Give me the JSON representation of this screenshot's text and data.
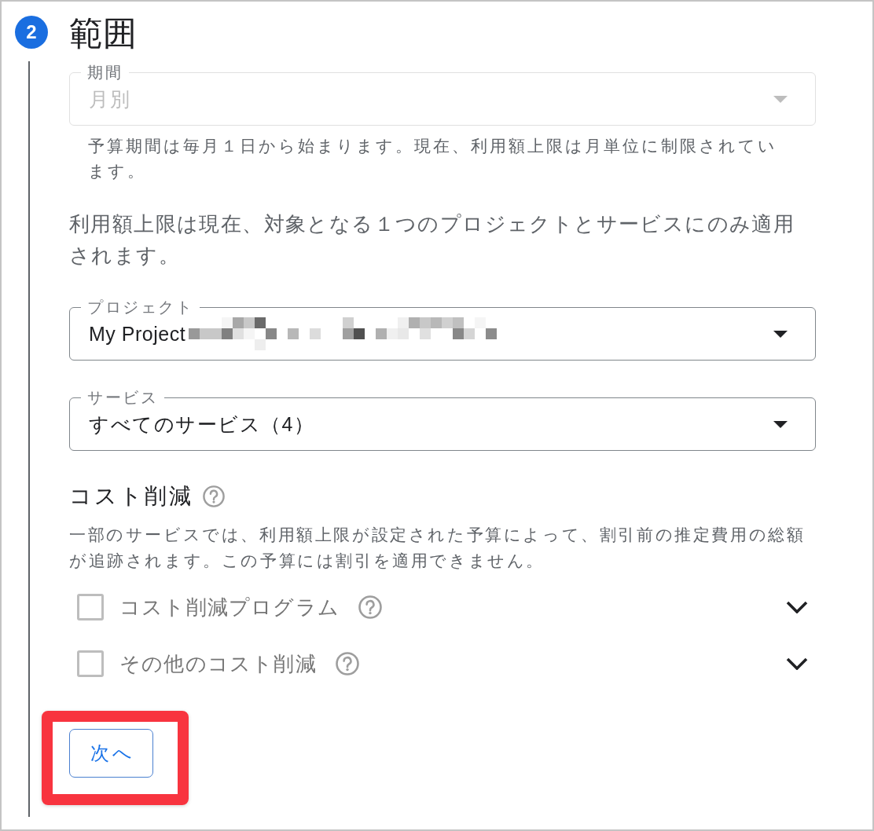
{
  "step": {
    "number": "2",
    "title": "範囲",
    "active": true
  },
  "period": {
    "label": "期間",
    "value": "月別",
    "disabled": true,
    "helper": "予算期間は毎月１日から始まります。現在、利用額上限は月単位に制限されています。"
  },
  "scope_note": "利用額上限は現在、対象となる１つのプロジェクトとサービスにのみ適用されます。",
  "project": {
    "label": "プロジェクト",
    "value": "My Project",
    "disabled": false
  },
  "services": {
    "label": "サービス",
    "value": "すべてのサービス（4）",
    "disabled": false
  },
  "cost_reduction": {
    "title": "コスト削減",
    "description": "一部のサービスでは、利用額上限が設定された予算によって、割引前の推定費用の総額が追跡されます。この予算には割引を適用できません。",
    "options": [
      {
        "label": "コスト削減プログラム",
        "checked": false,
        "disabled": true,
        "expanded": false
      },
      {
        "label": "その他のコスト削減",
        "checked": false,
        "disabled": true,
        "expanded": false
      }
    ]
  },
  "next_button": {
    "label": "次へ",
    "highlighted": true
  }
}
